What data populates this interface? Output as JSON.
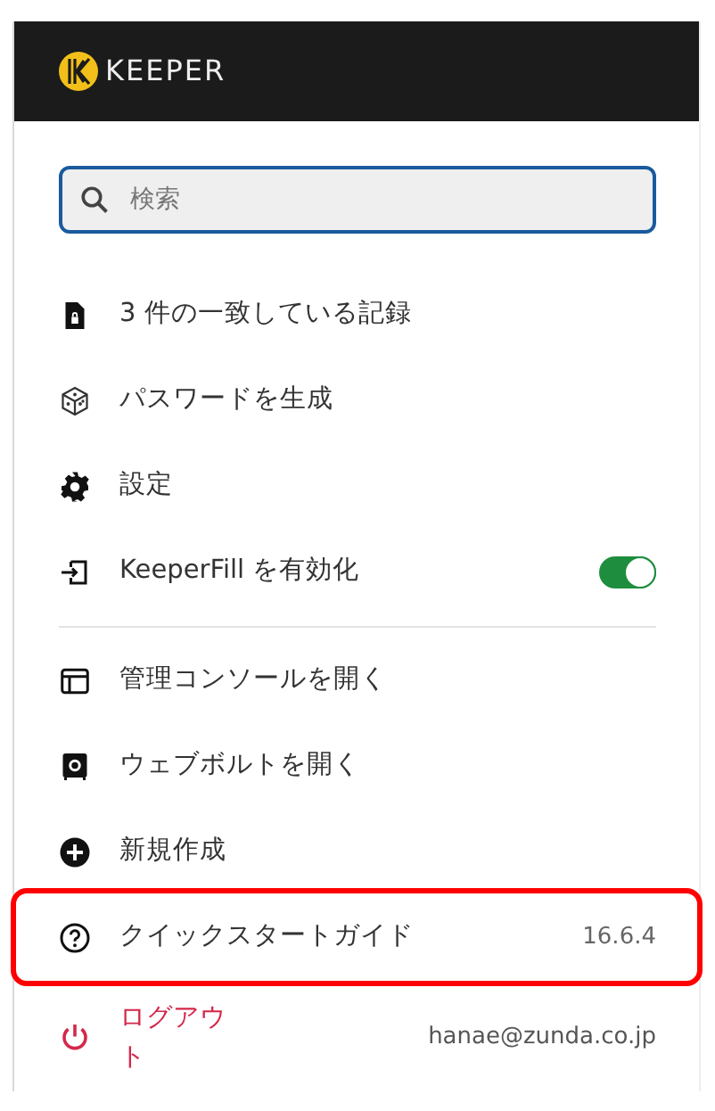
{
  "header": {
    "logo_text": "KEEPER"
  },
  "search": {
    "placeholder": "検索"
  },
  "sections": [
    {
      "items": [
        {
          "kind": "link",
          "label": "3 件の一致している記録",
          "highlighted": false
        },
        {
          "kind": "link",
          "label": "パスワードを生成",
          "highlighted": false
        },
        {
          "kind": "link",
          "label": "設定",
          "highlighted": false
        },
        {
          "kind": "toggle",
          "label": "KeeperFill を有効化",
          "on": true,
          "highlighted": false
        }
      ]
    },
    {
      "items": [
        {
          "kind": "link",
          "label": "管理コンソールを開く",
          "highlighted": false
        },
        {
          "kind": "link",
          "label": "ウェブボルトを開く",
          "highlighted": false
        },
        {
          "kind": "link",
          "label": "新規作成",
          "highlighted": false
        },
        {
          "kind": "version",
          "label": "クイックスタートガイド",
          "version": "16.6.4",
          "highlighted": true
        }
      ]
    }
  ],
  "footer": {
    "logout_label": "ログアウト",
    "account": "hanae@zunda.co.jp"
  }
}
